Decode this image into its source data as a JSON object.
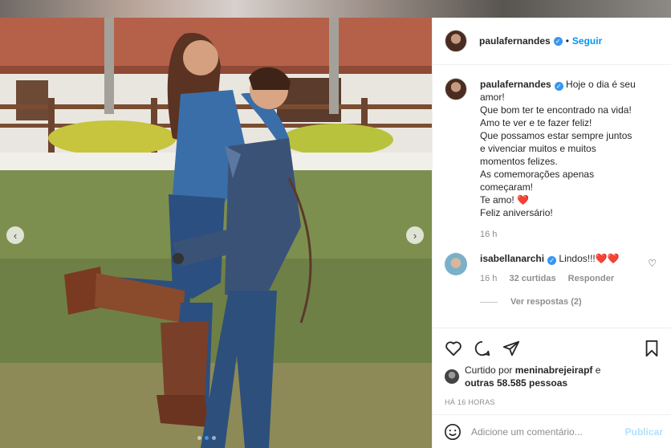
{
  "post": {
    "author": "paulafernandes",
    "follow_label": "Seguir",
    "separator": "•",
    "caption_lines": [
      "Hoje o dia é seu",
      "amor!",
      "Que bom ter te encontrado na vida!",
      "Amo te ver e te fazer feliz!",
      "Que possamos estar sempre juntos",
      "e vivenciar muitos e muitos",
      "momentos felizes.",
      "As comemorações apenas",
      "começaram!",
      "Te amo! ❤️",
      "Feliz aniversário!"
    ],
    "caption_time": "16 h",
    "image_dots": 3,
    "active_dot": 1
  },
  "comment": {
    "author": "isabellanarchi",
    "text": "Lindos!!!❤️❤️",
    "time": "16 h",
    "likes": "32 curtidas",
    "reply_label": "Responder",
    "view_replies": "Ver respostas (2)"
  },
  "likes": {
    "prefix": "Curtido por",
    "liker": "meninabrejeirapf",
    "and": "e",
    "others": "outras 58.585 pessoas"
  },
  "timestamp": "HÁ 16 HORAS",
  "add_comment": {
    "placeholder": "Adicione um comentário...",
    "publish_label": "Publicar"
  },
  "icons": {
    "prev": "chevron-left-icon",
    "next": "chevron-right-icon",
    "like": "heart-icon",
    "comment": "comment-icon",
    "share": "paper-plane-icon",
    "save": "bookmark-icon",
    "emoji": "emoji-icon",
    "verified": "verified-badge-icon"
  },
  "colors": {
    "accent": "#0095f6",
    "verified": "#3897f0",
    "muted": "#8e8e8e",
    "heart": "#ed4956"
  }
}
